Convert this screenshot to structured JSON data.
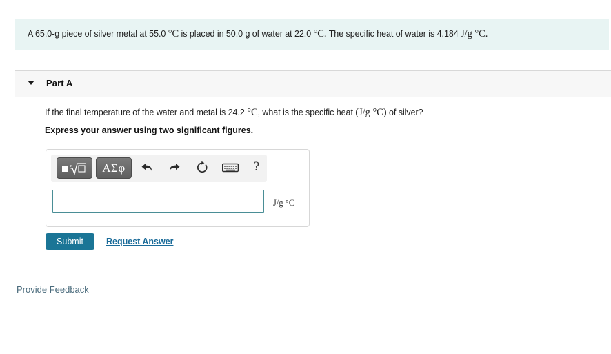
{
  "problem": {
    "segments": [
      {
        "t": "A 65.0-g piece of silver metal at 55.0 ",
        "style": "normal"
      },
      {
        "t": "°C",
        "style": "math"
      },
      {
        "t": " is placed in 50.0 g of water at 22.0 ",
        "style": "normal"
      },
      {
        "t": "°C.",
        "style": "math"
      },
      {
        "t": " The specific heat of water is 4.184 ",
        "style": "normal"
      },
      {
        "t": "J/g °C.",
        "style": "math"
      }
    ],
    "full_text": "A 65.0-g piece of silver metal at 55.0 °C is placed in 50.0 g of water at 22.0 °C. The specific heat of water is 4.184 J/g °C.",
    "mass_metal_g": "65.0",
    "metal": "silver",
    "metal_initial_temp_C": "55.0",
    "mass_water_g": "50.0",
    "water_initial_temp_C": "22.0",
    "specific_heat_water": "4.184",
    "specific_heat_water_units": "J/g °C",
    "background_color": "#e8f4f3"
  },
  "part": {
    "title": "Part A",
    "caret_icon": "caret-down-icon",
    "question_pre": "If the final temperature of the water and metal is 24.2 ",
    "question_temp_unit": "°C",
    "question_mid": ", what is the specific heat ",
    "question_units_math": "(J/g °C)",
    "question_post": " of silver?",
    "final_temp_C": "24.2",
    "instruction": "Express your answer using two significant figures."
  },
  "answer_widget": {
    "toolbar": {
      "sqrt_button_label": "■ⁿ√□",
      "sqrt_button_name": "template-sqrt-button",
      "greek_button_label": "ΑΣφ",
      "undo_icon": "undo-arrow-icon",
      "redo_icon": "redo-arrow-icon",
      "reset_icon": "reset-circular-arrow-icon",
      "keyboard_icon": "keyboard-icon",
      "help_label": "?"
    },
    "input_value": "",
    "input_placeholder": "",
    "units": "J/g °C",
    "input_border_color": "#4a8e96"
  },
  "actions": {
    "submit_label": "Submit",
    "submit_color": "#1a7596",
    "request_answer_label": "Request Answer",
    "link_color": "#1a6b99"
  },
  "footer": {
    "provide_feedback_label": "Provide Feedback"
  }
}
